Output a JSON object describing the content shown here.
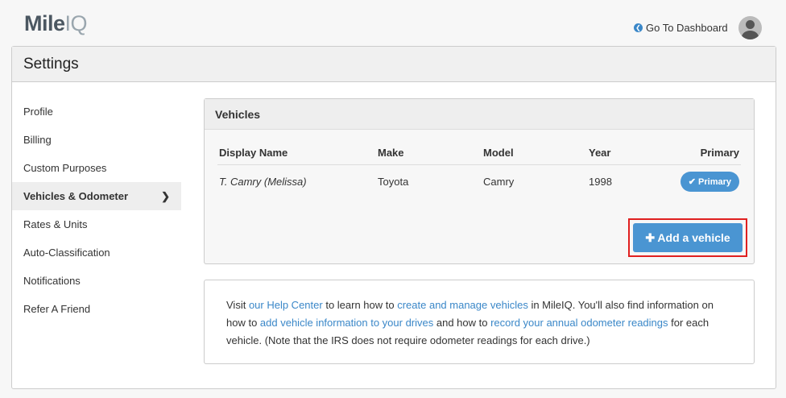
{
  "header": {
    "logo_main": "Mile",
    "logo_accent": "IQ",
    "dashboard_link": "Go To Dashboard"
  },
  "page_title": "Settings",
  "sidebar": {
    "items": [
      {
        "label": "Profile"
      },
      {
        "label": "Billing"
      },
      {
        "label": "Custom Purposes"
      },
      {
        "label": "Vehicles & Odometer"
      },
      {
        "label": "Rates & Units"
      },
      {
        "label": "Auto-Classification"
      },
      {
        "label": "Notifications"
      },
      {
        "label": "Refer A Friend"
      }
    ]
  },
  "vehicles": {
    "title": "Vehicles",
    "columns": [
      "Display Name",
      "Make",
      "Model",
      "Year",
      "Primary"
    ],
    "rows": [
      {
        "name": "T. Camry (Melissa)",
        "make": "Toyota",
        "model": "Camry",
        "year": "1998",
        "primary": "Primary"
      }
    ],
    "add_button": "Add a vehicle"
  },
  "info": {
    "t1": "Visit ",
    "l1": "our Help Center",
    "t2": " to learn how to ",
    "l2": "create and manage vehicles",
    "t3": " in MileIQ. You'll also find information on how to ",
    "l3": "add vehicle information to your drives",
    "t4": " and how to ",
    "l4": "record your annual odometer readings",
    "t5": " for each vehicle. (Note that the IRS does not require odometer readings for each drive.)"
  }
}
